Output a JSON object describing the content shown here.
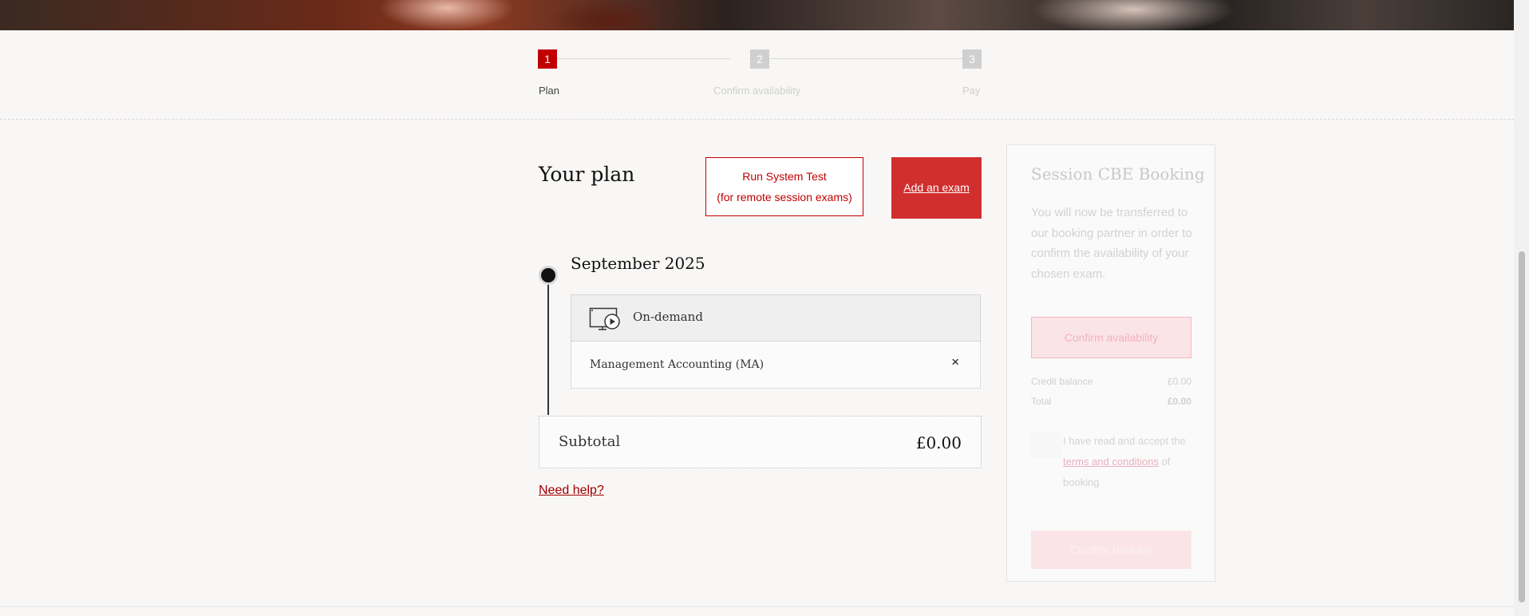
{
  "stepper": {
    "steps": [
      {
        "number": "1",
        "label": "Plan",
        "state": "active",
        "color": "#c00000"
      },
      {
        "number": "2",
        "label": "Confirm availability",
        "state": "inactive",
        "color": "#d0d0d0"
      },
      {
        "number": "3",
        "label": "Pay",
        "state": "inactive",
        "color": "#d0d0d0"
      }
    ]
  },
  "plan": {
    "title": "Your plan",
    "run_test_line1": "Run System Test",
    "run_test_line2": "(for remote session exams)",
    "add_exam_label": "Add an exam"
  },
  "timeline": {
    "month": "September 2025",
    "group": {
      "type_label": "On-demand",
      "icon": "on-demand-video-icon"
    },
    "exams": [
      {
        "name": "Management Accounting (MA)",
        "remove_icon": "×"
      }
    ]
  },
  "summary": {
    "subtotal_label": "Subtotal",
    "subtotal_value": "£0.00",
    "need_help": "Need help?"
  },
  "side_panel": {
    "title": "Session CBE Booking",
    "description": "You will now be transferred to our booking partner in order to confirm the availability of your chosen exam.",
    "confirm_button": "Confirm availability",
    "credit_label": "Credit balance",
    "credit_value": "£0.00",
    "total_label": "Total",
    "total_value": "£0.00",
    "terms_prefix": "I have read and accept the ",
    "terms_link": "terms and conditions",
    "terms_suffix": " of booking",
    "booking_button": "Confirm booking"
  },
  "colors": {
    "brand_red": "#c00000",
    "button_red": "#d12f2f"
  }
}
